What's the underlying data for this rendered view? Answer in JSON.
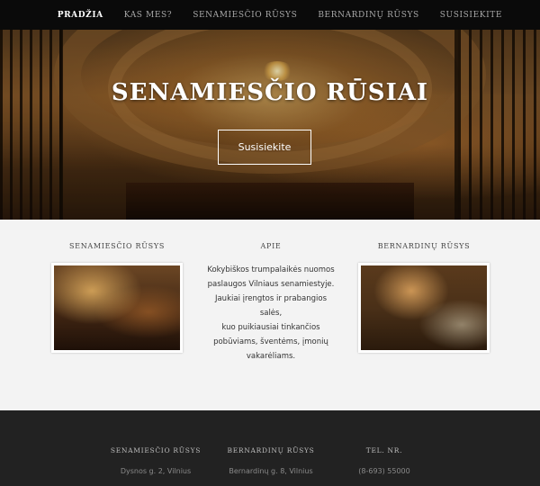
{
  "nav": {
    "items": [
      {
        "label": "Pradžia",
        "active": true
      },
      {
        "label": "Kas mes?"
      },
      {
        "label": "Senamiesčio rūsys"
      },
      {
        "label": "Bernardinų rūsys"
      },
      {
        "label": "Susisiekite"
      }
    ]
  },
  "hero": {
    "title": "SENAMIESČIO RŪSIAI",
    "button_label": "Susisiekite"
  },
  "main": {
    "col1": {
      "title": "Senamiesčio rūsys"
    },
    "col2": {
      "title": "Apie",
      "lines": [
        "Kokybiškos trumpalaikės nuomos",
        "paslaugos Vilniaus senamiestyje.",
        "Jaukiai įrengtos ir prabangios salės,",
        "kuo puikiausiai tinkančios",
        "pobūviams, šventėms, įmonių",
        "vakarėliams."
      ]
    },
    "col3": {
      "title": "Bernardinų rūsys"
    }
  },
  "footer": {
    "col1": {
      "title": "Senamiesčio rūsys",
      "text": "Dysnos g. 2, Vilnius"
    },
    "col2": {
      "title": "Bernardinų rūsys",
      "text": "Bernardinų g. 8, Vilnius"
    },
    "col3": {
      "title": "Tel. nr.",
      "text": "(8-693) 55000"
    }
  }
}
